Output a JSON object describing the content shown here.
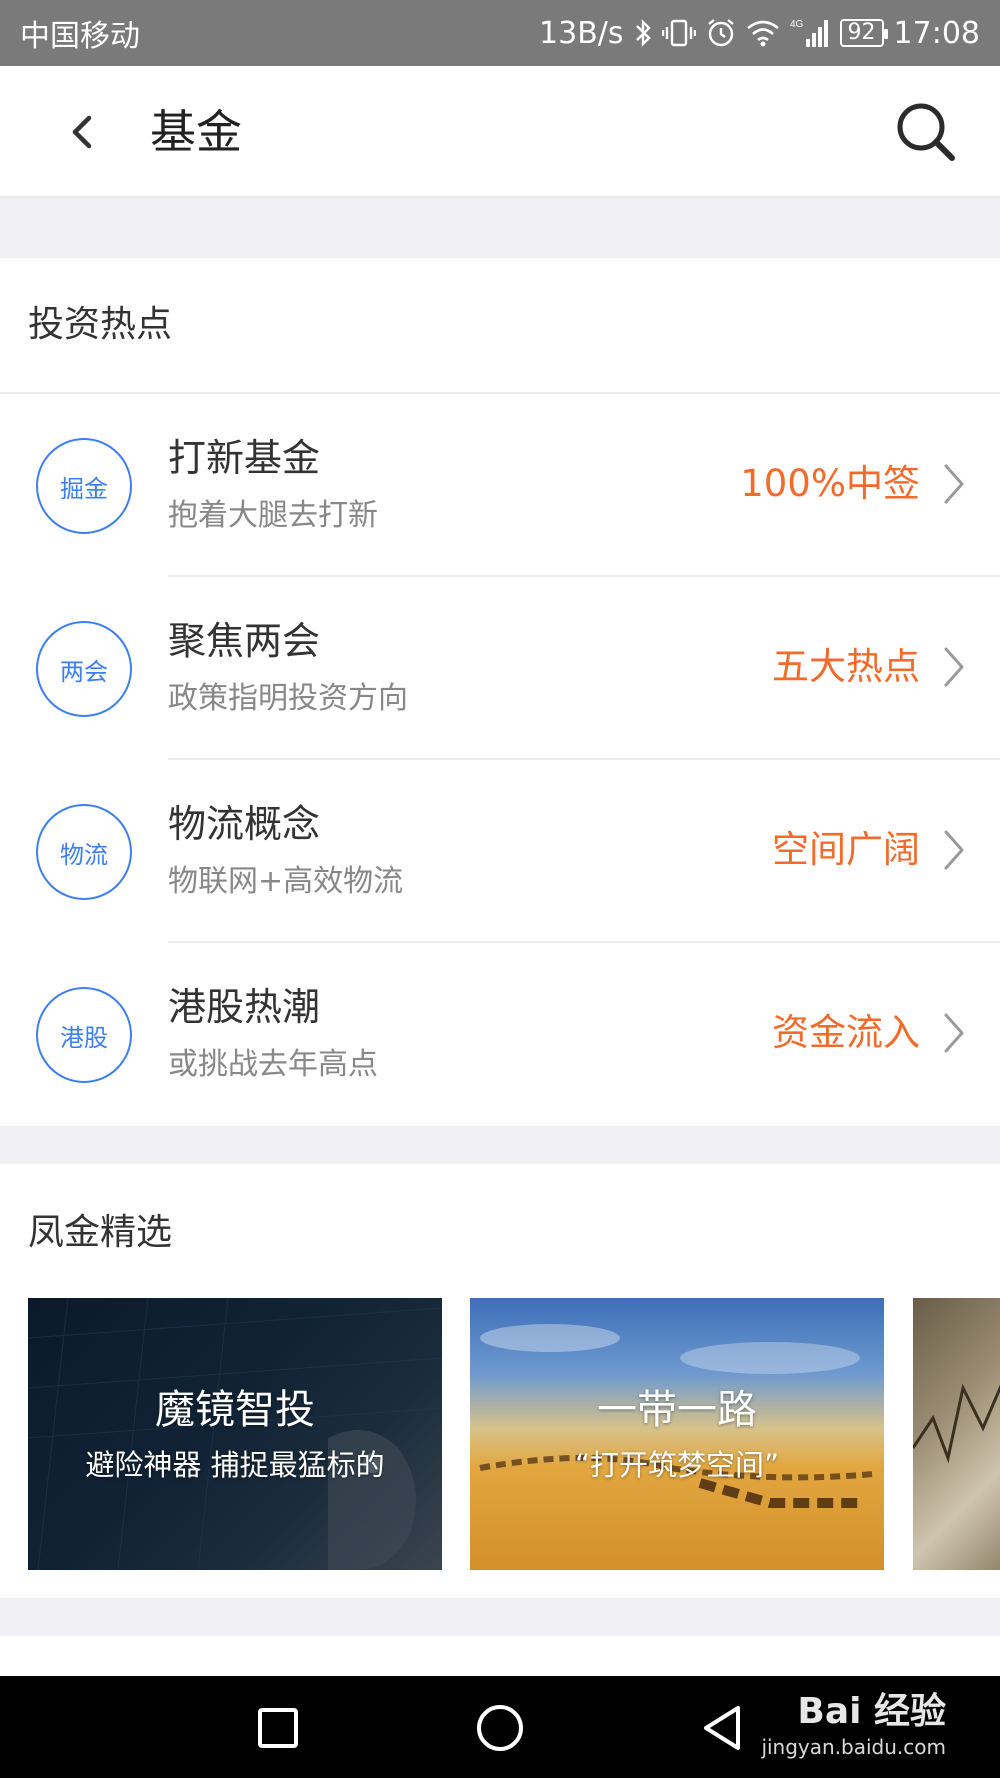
{
  "status_bar": {
    "carrier": "中国移动",
    "speed": "13B/s",
    "network": "4G",
    "battery": "92",
    "time": "17:08"
  },
  "header": {
    "title": "基金"
  },
  "hot_section": {
    "title": "投资热点",
    "items": [
      {
        "badge": "掘金",
        "name": "打新基金",
        "desc": "抱着大腿去打新",
        "tag": "100%中签"
      },
      {
        "badge": "两会",
        "name": "聚焦两会",
        "desc": "政策指明投资方向",
        "tag": "五大热点"
      },
      {
        "badge": "物流",
        "name": "物流概念",
        "desc": "物联网+高效物流",
        "tag": "空间广阔"
      },
      {
        "badge": "港股",
        "name": "港股热潮",
        "desc": "或挑战去年高点",
        "tag": "资金流入"
      }
    ]
  },
  "featured_section": {
    "title": "凤金精选",
    "cards": [
      {
        "title": "魔镜智投",
        "subtitle": "避险神器 捕捉最猛标的"
      },
      {
        "title": "一带一路",
        "subtitle": "“打开筑梦空间”"
      }
    ]
  },
  "watermark": {
    "brand": "Bai 经验",
    "url": "jingyan.baidu.com"
  },
  "colors": {
    "accent_blue": "#3d7ff2",
    "tag_orange": "#f26b2b",
    "status_bar": "#7a7a7a"
  }
}
